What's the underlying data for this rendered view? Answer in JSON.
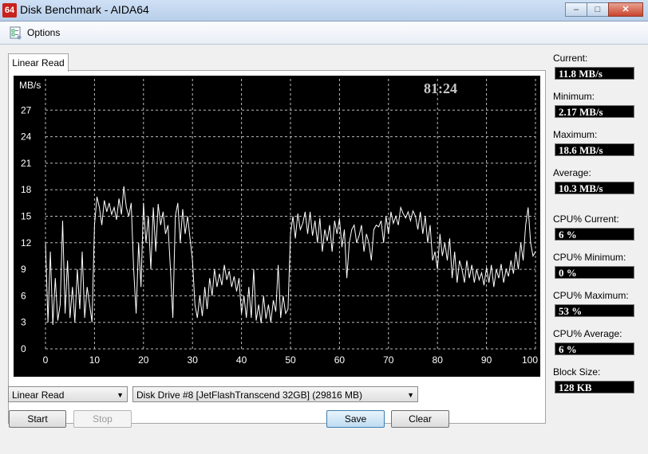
{
  "window": {
    "title": "Disk Benchmark - AIDA64",
    "app_icon": "64",
    "minimize": "–",
    "maximize": "□",
    "close": "✕"
  },
  "menu": {
    "options_label": "Options"
  },
  "tab": {
    "label": "Linear Read"
  },
  "chart_data": {
    "type": "line",
    "ylabel": "MB/s",
    "xlabel": "",
    "title": "",
    "timer": "81:24",
    "x_ticks": [
      "0",
      "10",
      "20",
      "30",
      "40",
      "50",
      "60",
      "70",
      "80",
      "90",
      "100 %"
    ],
    "y_ticks": [
      "0",
      "3",
      "6",
      "9",
      "12",
      "15",
      "18",
      "21",
      "24",
      "27"
    ],
    "ylim": [
      0,
      30
    ],
    "xlim": [
      0,
      100
    ],
    "grid": true,
    "background": "#000000",
    "line_color": "#ffffff",
    "grid_color": "#bcbcbc",
    "series": [
      {
        "points": [
          [
            0,
            12
          ],
          [
            0.5,
            3
          ],
          [
            1,
            11
          ],
          [
            1.5,
            2.7
          ],
          [
            2,
            8
          ],
          [
            2.5,
            3.2
          ],
          [
            3,
            5
          ],
          [
            3.5,
            14.5
          ],
          [
            4,
            4
          ],
          [
            4.5,
            10
          ],
          [
            5,
            3.5
          ],
          [
            5.5,
            7
          ],
          [
            6,
            3
          ],
          [
            6.5,
            9
          ],
          [
            7,
            4.5
          ],
          [
            7.5,
            11
          ],
          [
            8,
            3.5
          ],
          [
            8.5,
            7
          ],
          [
            9,
            5
          ],
          [
            9.5,
            3
          ],
          [
            10,
            14
          ],
          [
            10.5,
            17.2
          ],
          [
            11,
            16
          ],
          [
            11.5,
            14
          ],
          [
            12,
            16.8
          ],
          [
            12.5,
            15.5
          ],
          [
            13,
            16.5
          ],
          [
            13.5,
            15.2
          ],
          [
            14,
            16
          ],
          [
            14.5,
            14.6
          ],
          [
            15,
            17
          ],
          [
            15.5,
            15.2
          ],
          [
            16,
            18.4
          ],
          [
            16.5,
            16
          ],
          [
            17,
            15
          ],
          [
            17.5,
            16.5
          ],
          [
            18,
            9
          ],
          [
            18.5,
            4
          ],
          [
            19,
            12
          ],
          [
            19.5,
            7
          ],
          [
            20,
            16.5
          ],
          [
            20.5,
            12
          ],
          [
            21,
            15
          ],
          [
            21.5,
            9
          ],
          [
            22,
            16
          ],
          [
            22.5,
            11
          ],
          [
            23,
            16.4
          ],
          [
            23.5,
            14
          ],
          [
            24,
            15.5
          ],
          [
            24.5,
            13
          ],
          [
            25,
            14
          ],
          [
            25.5,
            9
          ],
          [
            26,
            3.5
          ],
          [
            26.5,
            15
          ],
          [
            27,
            16.5
          ],
          [
            27.5,
            12
          ],
          [
            28,
            15.8
          ],
          [
            28.5,
            13
          ],
          [
            29,
            15
          ],
          [
            29.5,
            12.5
          ],
          [
            30,
            10
          ],
          [
            30.5,
            5
          ],
          [
            31,
            3.5
          ],
          [
            31.5,
            6
          ],
          [
            32,
            3.7
          ],
          [
            32.5,
            7
          ],
          [
            33,
            4.5
          ],
          [
            33.5,
            8
          ],
          [
            34,
            6
          ],
          [
            34.5,
            9
          ],
          [
            35,
            7
          ],
          [
            35.5,
            8.5
          ],
          [
            36,
            7.2
          ],
          [
            36.5,
            9.5
          ],
          [
            37,
            7.8
          ],
          [
            37.5,
            8.8
          ],
          [
            38,
            7
          ],
          [
            38.5,
            8.2
          ],
          [
            39,
            6.5
          ],
          [
            39.5,
            8
          ],
          [
            40,
            4
          ],
          [
            40.5,
            6
          ],
          [
            41,
            3.5
          ],
          [
            41.5,
            7
          ],
          [
            42,
            3.5
          ],
          [
            42.5,
            9
          ],
          [
            43,
            3.2
          ],
          [
            43.5,
            5
          ],
          [
            44,
            2.9
          ],
          [
            44.5,
            6
          ],
          [
            45,
            3.4
          ],
          [
            45.5,
            5
          ],
          [
            46,
            3
          ],
          [
            46.5,
            5.5
          ],
          [
            47,
            4.2
          ],
          [
            47.5,
            9.5
          ],
          [
            48,
            3.5
          ],
          [
            48.5,
            6
          ],
          [
            49,
            4
          ],
          [
            49.5,
            4.5
          ],
          [
            50,
            13
          ],
          [
            50.5,
            15
          ],
          [
            51,
            12.5
          ],
          [
            51.5,
            15.3
          ],
          [
            52,
            13.5
          ],
          [
            52.5,
            14.2
          ],
          [
            53,
            15.5
          ],
          [
            53.5,
            13
          ],
          [
            54,
            15.5
          ],
          [
            54.5,
            12.8
          ],
          [
            55,
            14.5
          ],
          [
            55.5,
            12
          ],
          [
            56,
            14.8
          ],
          [
            56.5,
            11
          ],
          [
            57,
            13.5
          ],
          [
            57.5,
            12.2
          ],
          [
            58,
            14
          ],
          [
            58.5,
            11
          ],
          [
            59,
            14.5
          ],
          [
            59.5,
            13
          ],
          [
            60,
            14.7
          ],
          [
            60.5,
            11.5
          ],
          [
            61,
            13.5
          ],
          [
            61.5,
            8
          ],
          [
            62,
            12
          ],
          [
            62.5,
            13.5
          ],
          [
            63,
            14
          ],
          [
            63.5,
            12
          ],
          [
            64,
            12.8
          ],
          [
            64.5,
            14
          ],
          [
            65,
            11
          ],
          [
            65.5,
            13
          ],
          [
            66,
            12
          ],
          [
            66.5,
            10
          ],
          [
            67,
            13.5
          ],
          [
            67.5,
            14
          ],
          [
            68,
            13.8
          ],
          [
            68.5,
            14.5
          ],
          [
            69,
            12
          ],
          [
            69.5,
            15
          ],
          [
            70,
            13
          ],
          [
            70.5,
            15.5
          ],
          [
            71,
            14.2
          ],
          [
            71.5,
            15
          ],
          [
            72,
            14
          ],
          [
            72.5,
            16
          ],
          [
            73,
            15.3
          ],
          [
            73.5,
            14.8
          ],
          [
            74,
            15.5
          ],
          [
            74.5,
            14.5
          ],
          [
            75,
            15.6
          ],
          [
            75.5,
            15
          ],
          [
            76,
            13.5
          ],
          [
            76.5,
            15.5
          ],
          [
            77,
            13
          ],
          [
            77.5,
            15
          ],
          [
            78,
            12
          ],
          [
            78.5,
            14
          ],
          [
            79,
            10
          ],
          [
            79.5,
            11
          ],
          [
            80,
            9
          ],
          [
            80.5,
            13
          ],
          [
            81,
            10.5
          ],
          [
            81.5,
            12
          ],
          [
            82,
            10
          ],
          [
            82.5,
            12.5
          ],
          [
            83,
            8
          ],
          [
            83.5,
            11
          ],
          [
            84,
            7.5
          ],
          [
            84.5,
            10
          ],
          [
            85,
            9
          ],
          [
            85.5,
            7.5
          ],
          [
            86,
            10
          ],
          [
            86.5,
            8
          ],
          [
            87,
            9.5
          ],
          [
            87.5,
            7.5
          ],
          [
            88,
            9
          ],
          [
            88.5,
            7.8
          ],
          [
            89,
            8.6
          ],
          [
            89.5,
            7.2
          ],
          [
            90,
            9.2
          ],
          [
            90.5,
            7.5
          ],
          [
            91,
            9.5
          ],
          [
            91.5,
            7
          ],
          [
            92,
            9
          ],
          [
            92.5,
            8
          ],
          [
            93,
            9.6
          ],
          [
            93.5,
            7.5
          ],
          [
            94,
            9
          ],
          [
            94.5,
            8.2
          ],
          [
            95,
            10
          ],
          [
            95.5,
            8.5
          ],
          [
            96,
            11
          ],
          [
            96.5,
            9
          ],
          [
            97,
            12
          ],
          [
            97.5,
            10
          ],
          [
            98,
            14
          ],
          [
            98.5,
            16
          ],
          [
            99,
            12
          ],
          [
            99.5,
            10.5
          ],
          [
            100,
            11
          ]
        ]
      }
    ]
  },
  "stats": [
    {
      "label": "Current:",
      "value": "11.8 MB/s"
    },
    {
      "label": "Minimum:",
      "value": "2.17 MB/s"
    },
    {
      "label": "Maximum:",
      "value": "18.6 MB/s"
    },
    {
      "label": "Average:",
      "value": "10.3 MB/s"
    },
    {
      "label": "CPU% Current:",
      "value": "6 %"
    },
    {
      "label": "CPU% Minimum:",
      "value": "0 %"
    },
    {
      "label": "CPU% Maximum:",
      "value": "53 %"
    },
    {
      "label": "CPU% Average:",
      "value": "6 %"
    },
    {
      "label": "Block Size:",
      "value": "128 KB"
    }
  ],
  "controls": {
    "test_select": "Linear Read",
    "drive_select": "Disk Drive #8  [JetFlashTranscend 32GB]  (29816 MB)",
    "start": "Start",
    "stop": "Stop",
    "save": "Save",
    "clear": "Clear"
  }
}
